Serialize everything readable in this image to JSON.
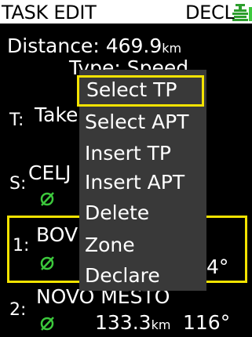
{
  "header": {
    "title": "TASK EDIT",
    "status": "DECL"
  },
  "distance": {
    "label": "Distance:",
    "value": "469.9",
    "unit": "km"
  },
  "type_line": {
    "text": "Type: Speed"
  },
  "rows": [
    {
      "prefix": "T:",
      "name": "Take"
    },
    {
      "prefix": "S:",
      "name": "CELJ"
    },
    {
      "prefix": "1:",
      "name": "BOV",
      "bearing": "4°"
    },
    {
      "prefix": "2:",
      "name": "NOVO MESTO",
      "distance": "133.3",
      "unit": "km",
      "bearing": "116°"
    }
  ],
  "menu": {
    "items": [
      "Select TP",
      "Select APT",
      "Insert TP",
      "Insert APT",
      "Delete",
      "Zone",
      "Declare"
    ]
  },
  "colors": {
    "highlight": "#f4e300",
    "accent_green": "#3cc83c",
    "menu_bg": "#393939"
  },
  "icons": [
    "gps-antenna-icon",
    "no-entry-icon"
  ]
}
